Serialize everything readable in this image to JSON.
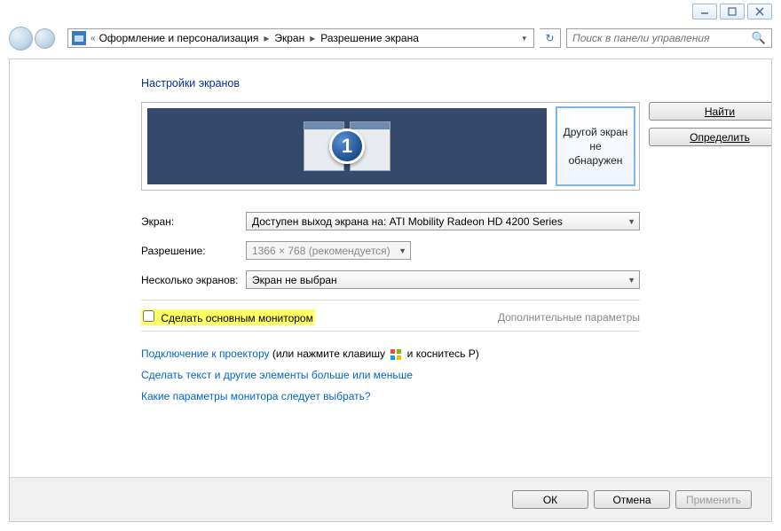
{
  "chrome": {
    "min": "_",
    "max": "▢",
    "close": "✕"
  },
  "breadcrumb": {
    "item1": "Оформление и персонализация",
    "item2": "Экран",
    "item3": "Разрешение экрана"
  },
  "search": {
    "placeholder": "Поиск в панели управления"
  },
  "page": {
    "title": "Настройки экранов"
  },
  "display_preview": {
    "monitor_number": "1",
    "nodetect": "Другой экран не обнаружен"
  },
  "side_buttons": {
    "find": "Найти",
    "detect": "Определить"
  },
  "form": {
    "screen_label": "Экран:",
    "screen_value": "Доступен выход экрана на: ATI Mobility Radeon HD 4200 Series",
    "resolution_label": "Разрешение:",
    "resolution_value": "1366 × 768 (рекомендуется)",
    "multi_label": "Несколько экранов:",
    "multi_value": "Экран не выбран"
  },
  "checkbox": {
    "label": "Сделать основным монитором"
  },
  "advanced": "Дополнительные параметры",
  "links": {
    "projector_link": "Подключение к проектору",
    "projector_suffix1": " (или нажмите клавишу ",
    "projector_suffix2": " и коснитесь P)",
    "text_size": "Сделать текст и другие элементы больше или меньше",
    "which_params": "Какие параметры монитора следует выбрать?"
  },
  "buttons": {
    "ok": "ОК",
    "cancel": "Отмена",
    "apply": "Применить"
  }
}
